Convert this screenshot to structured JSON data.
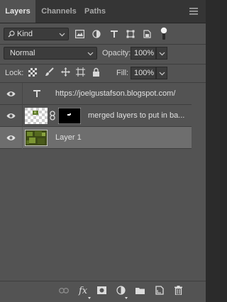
{
  "tabs": [
    {
      "label": "Layers"
    },
    {
      "label": "Channels"
    },
    {
      "label": "Paths"
    }
  ],
  "filter": {
    "kind_label": "Kind"
  },
  "blend": {
    "mode": "Normal",
    "opacity_label": "Opacity:",
    "opacity_value": "100%"
  },
  "lock": {
    "label": "Lock:",
    "fill_label": "Fill:",
    "fill_value": "100%"
  },
  "layers": [
    {
      "name": "https://joelgustafson.blogspot.com/",
      "type": "text"
    },
    {
      "name": "merged layers to put in ba...",
      "type": "masked"
    },
    {
      "name": "Layer 1",
      "type": "image",
      "selected": true
    }
  ],
  "bottom_icons": [
    "link-icon",
    "fx-icon",
    "mask-icon",
    "adjustment-icon",
    "folder-icon",
    "new-layer-icon",
    "trash-icon"
  ],
  "colors": {
    "panel": "#535353",
    "tabbar": "#353535",
    "selected": "#6e6e6e",
    "field": "#3c3c3c"
  }
}
